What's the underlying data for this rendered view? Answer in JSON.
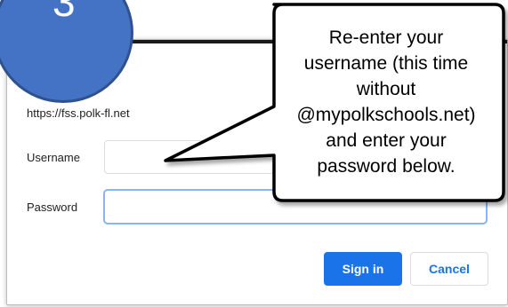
{
  "step_badge": {
    "number": "3",
    "color": "#4472c4"
  },
  "dialog": {
    "origin": "https://fss.polk-fl.net",
    "username_label": "Username",
    "username_value": "",
    "password_label": "Password",
    "password_value": "",
    "signin_label": "Sign in",
    "cancel_label": "Cancel",
    "accent": "#1a73e8"
  },
  "callout": {
    "lines": [
      "Re-enter your",
      "username (this time",
      "without",
      "@mypolkschools.net)",
      "and enter your",
      "password below."
    ]
  }
}
